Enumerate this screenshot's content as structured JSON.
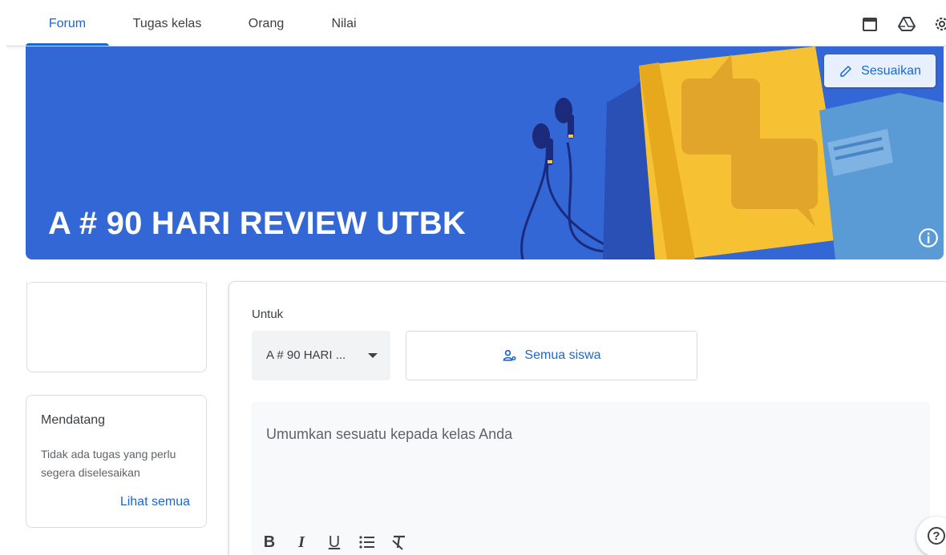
{
  "nav": {
    "tabs": [
      {
        "label": "Forum",
        "active": true
      },
      {
        "label": "Tugas kelas",
        "active": false
      },
      {
        "label": "Orang",
        "active": false
      },
      {
        "label": "Nilai",
        "active": false
      }
    ],
    "icons": [
      "calendar-icon",
      "drive-icon",
      "settings-icon"
    ]
  },
  "banner": {
    "title": "A # 90 HARI REVIEW UTBK",
    "customize_label": "Sesuaikan",
    "background_color": "#3367d6"
  },
  "upcoming": {
    "title": "Mendatang",
    "text": "Tidak ada tugas yang perlu segera diselesaikan",
    "link": "Lihat semua"
  },
  "composer": {
    "for_label": "Untuk",
    "class_value": "A # 90 HARI ...",
    "students_label": "Semua siswa",
    "placeholder": "Umumkan sesuatu kepada kelas Anda",
    "format_buttons": [
      "B",
      "I",
      "U",
      "list",
      "clear-format"
    ]
  },
  "colors": {
    "accent": "#1967d2"
  }
}
